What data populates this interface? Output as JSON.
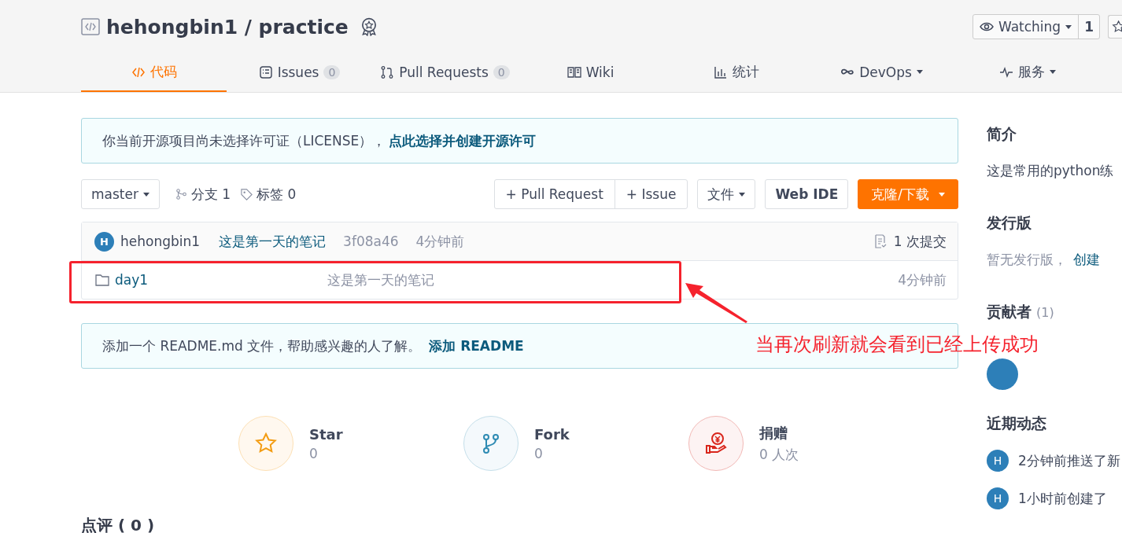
{
  "repo": {
    "title": "hehongbin1 / practice"
  },
  "watch": {
    "label": "Watching",
    "count": "1"
  },
  "tabs": [
    {
      "label": "代码",
      "selected": true,
      "dropdown": false
    },
    {
      "label": "Issues",
      "count": "0",
      "selected": false,
      "dropdown": false
    },
    {
      "label": "Pull Requests",
      "count": "0",
      "selected": false,
      "dropdown": false
    },
    {
      "label": "Wiki",
      "selected": false,
      "dropdown": false
    },
    {
      "label": "统计",
      "selected": false,
      "dropdown": false
    },
    {
      "label": "DevOps",
      "selected": false,
      "dropdown": true
    },
    {
      "label": "服务",
      "selected": false,
      "dropdown": true
    }
  ],
  "license_notice": {
    "text": "你当前开源项目尚未选择许可证（LICENSE），",
    "link": "点此选择并创建开源许可"
  },
  "toolbar": {
    "branch": "master",
    "branches": "分支 1",
    "tags": "标签 0",
    "actions": [
      "+ Pull Request",
      "+ Issue"
    ],
    "file_menu": "文件",
    "web_ide": "Web IDE",
    "clone": "克隆/下载"
  },
  "commit": {
    "avatar": "H",
    "author": "hehongbin1",
    "message": "这是第一天的笔记",
    "hash": "3f08a46",
    "time": "4分钟前",
    "count": "1 次提交"
  },
  "files": [
    {
      "kind": "folder",
      "name": "day1",
      "message": "这是第一天的笔记",
      "time": "4分钟前"
    }
  ],
  "readme_notice": {
    "text": "添加一个 README.md 文件，帮助感兴趣的人了解。",
    "link": "添加 README"
  },
  "stats": [
    {
      "kind": "star",
      "label": "Star",
      "value": "0"
    },
    {
      "kind": "fork",
      "label": "Fork",
      "value": "0"
    },
    {
      "kind": "donate",
      "label": "捐赠",
      "value": "0 人次"
    }
  ],
  "review_heading": "点评 ( 0 )",
  "sidebar": {
    "intro_title": "简介",
    "intro": "这是常用的python练",
    "releases_title": "发行版",
    "releases_text": "暂无发行版，",
    "releases_link": "创建",
    "contributors_title": "贡献者",
    "contributors_count": "(1)",
    "contributors": [
      {
        "kind": "avatar"
      }
    ],
    "activity_title": "近期动态",
    "activity": [
      {
        "avatar": "H",
        "text": "2分钟前推送了新"
      },
      {
        "avatar": "H",
        "text": "1小时前创建了"
      }
    ]
  },
  "annotation": {
    "text": "当再次刷新就会看到已经上传成功"
  }
}
